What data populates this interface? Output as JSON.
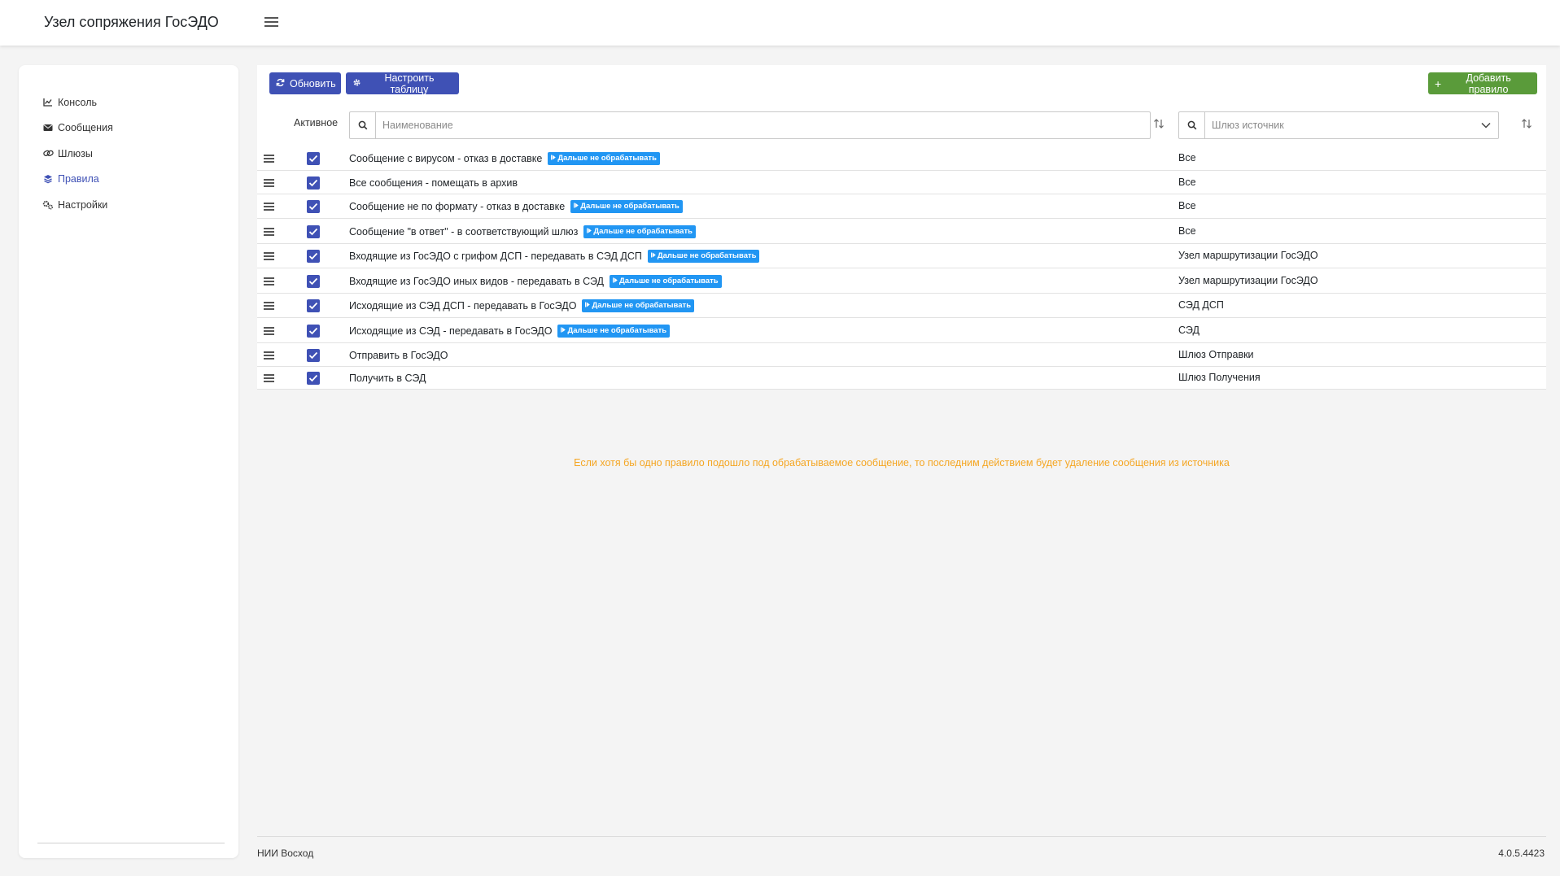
{
  "header": {
    "app_title": "Узел сопряжения ГосЭДО"
  },
  "sidebar": {
    "items": [
      {
        "label": "Консоль",
        "icon": "chart-line-icon",
        "active": false
      },
      {
        "label": "Сообщения",
        "icon": "envelope-icon",
        "active": false
      },
      {
        "label": "Шлюзы",
        "icon": "link-icon",
        "active": false
      },
      {
        "label": "Правила",
        "icon": "layers-icon",
        "active": true
      },
      {
        "label": "Настройки",
        "icon": "cogs-icon",
        "active": false
      }
    ]
  },
  "toolbar": {
    "refresh_label": "Обновить",
    "configure_label": "Настроить таблицу",
    "add_label": "Добавить правило"
  },
  "filters": {
    "active_label": "Активное",
    "name_placeholder": "Наименование",
    "gateway_placeholder": "Шлюз источник"
  },
  "rules": [
    {
      "name": "Сообщение с вирусом - отказ в доставке",
      "badge": "Дальше не обрабатывать",
      "gateway": "Все",
      "active": true
    },
    {
      "name": "Все сообщения - помещать в архив",
      "badge": "",
      "gateway": "Все",
      "active": true
    },
    {
      "name": "Сообщение не по формату - отказ в доставке",
      "badge": "Дальше не обрабатывать",
      "gateway": "Все",
      "active": true
    },
    {
      "name": "Сообщение \"в ответ\" - в соответствующий шлюз",
      "badge": "Дальше не обрабатывать",
      "gateway": "Все",
      "active": true
    },
    {
      "name": "Входящие из ГосЭДО с грифом ДСП - передавать в СЭД ДСП",
      "badge": "Дальше не обрабатывать",
      "gateway": "Узел маршрутизации ГосЭДО",
      "active": true
    },
    {
      "name": "Входящие из ГосЭДО иных видов - передавать в СЭД",
      "badge": "Дальше не обрабатывать",
      "gateway": "Узел маршрутизации ГосЭДО",
      "active": true
    },
    {
      "name": "Исходящие из СЭД ДСП - передавать в ГосЭДО",
      "badge": "Дальше не обрабатывать",
      "gateway": "СЭД ДСП",
      "active": true
    },
    {
      "name": "Исходящие из СЭД - передавать в ГосЭДО",
      "badge": "Дальше не обрабатывать",
      "gateway": "СЭД",
      "active": true
    },
    {
      "name": "Отправить в ГосЭДО",
      "badge": "",
      "gateway": "Шлюз Отправки",
      "active": true
    },
    {
      "name": "Получить в СЭД",
      "badge": "",
      "gateway": "Шлюз Получения",
      "active": true
    }
  ],
  "note": "Если хотя бы одно правило подошло под обрабатываемое сообщение, то последним действием будет удаление сообщения из источника",
  "footer": {
    "company": "НИИ Восход",
    "version": "4.0.5.4423"
  },
  "colors": {
    "primary": "#3f51b5",
    "success": "#5a9b3a",
    "badge": "#2196f3",
    "note": "#f5a623"
  }
}
